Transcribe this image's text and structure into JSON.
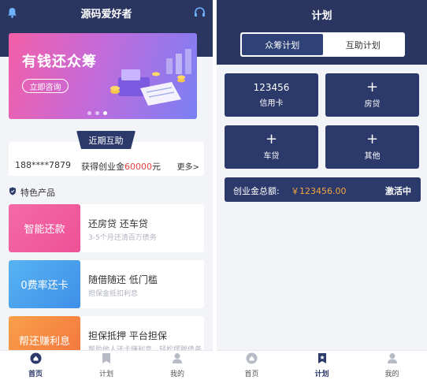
{
  "left": {
    "header": {
      "title": "源码爱好者"
    },
    "banner": {
      "title": "有钱还众筹",
      "button": "立即咨询",
      "slides": 3,
      "active_slide": 3,
      "gradient": [
        "#f35fa7",
        "#c56ad9",
        "#7a80f5"
      ]
    },
    "section_tab": "近期互助",
    "ticker": {
      "user": "188****7879",
      "text_prefix": "获得创业金",
      "amount": "60000",
      "text_suffix": "元",
      "more": "更多>"
    },
    "special": {
      "heading": "特色产品"
    },
    "products": [
      {
        "thumb": "智能还款",
        "title": "还房贷 还车贷",
        "desc": "3-5个月还清百万债务",
        "color_from": "#f36aa6",
        "color_to": "#ee5197"
      },
      {
        "thumb": "0费率还卡",
        "title": "随借随还 低门槛",
        "desc": "担保金抵扣利息",
        "color_from": "#58b3f2",
        "color_to": "#3f8fe8"
      },
      {
        "thumb": "帮还赚利息",
        "title": "担保抵押 平台担保",
        "desc": "帮助他人还卡赚利息，轻松摆脱债务",
        "color_from": "#f9a04a",
        "color_to": "#f3733c"
      }
    ],
    "tabbar": [
      {
        "label": "首页",
        "icon": "home-icon",
        "active": true
      },
      {
        "label": "计划",
        "icon": "plan-icon",
        "active": false
      },
      {
        "label": "我的",
        "icon": "user-icon",
        "active": false
      }
    ]
  },
  "right": {
    "header": {
      "title": "计划"
    },
    "segments": [
      {
        "label": "众筹计划",
        "active": true
      },
      {
        "label": "互助计划",
        "active": false
      }
    ],
    "cards": [
      {
        "number": "123456",
        "label": "信用卡",
        "icon": null
      },
      {
        "number": null,
        "label": "房贷",
        "icon": "plus-icon"
      },
      {
        "number": null,
        "label": "车贷",
        "icon": "plus-icon"
      },
      {
        "number": null,
        "label": "其他",
        "icon": "plus-icon"
      }
    ],
    "total": {
      "label": "创业金总额:",
      "amount": "￥123456.00",
      "status": "激活中"
    },
    "tabbar": [
      {
        "label": "首页",
        "icon": "home-icon",
        "active": false
      },
      {
        "label": "计划",
        "icon": "plan-icon",
        "active": true
      },
      {
        "label": "我的",
        "icon": "user-icon",
        "active": false
      }
    ]
  },
  "colors": {
    "navy": "#2a3560",
    "card": "#2c3a6b",
    "accent_red": "#e8403f",
    "accent_orange": "#f4a43a",
    "background": "#f3f4f8"
  }
}
